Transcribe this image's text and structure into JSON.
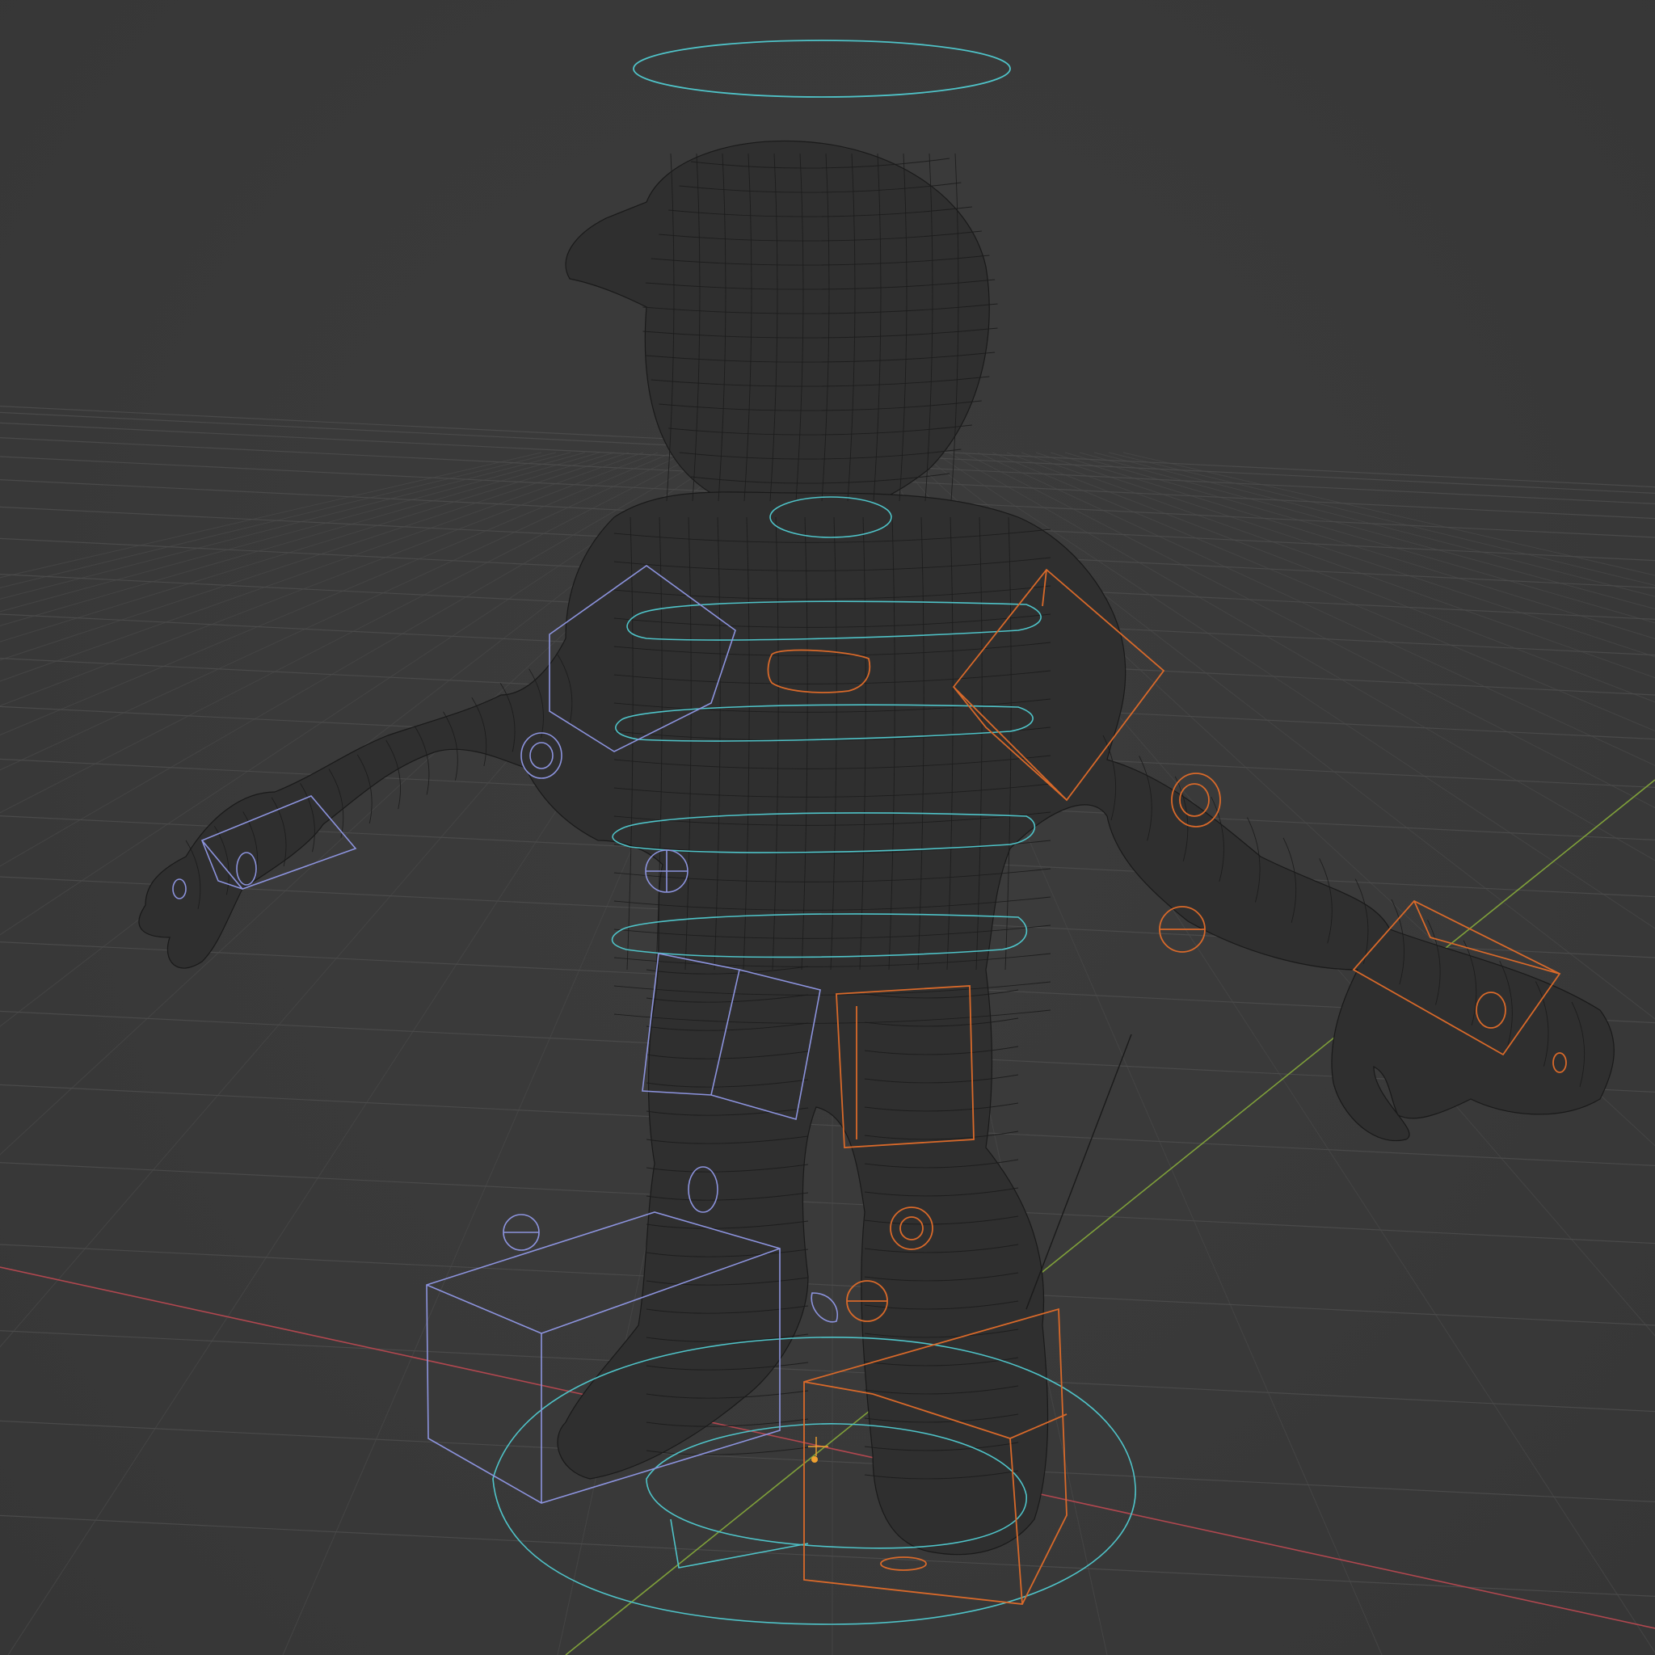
{
  "viewport": {
    "background": "#3a3a3a",
    "mode": "wireframe"
  },
  "colors": {
    "grid": "#4a4a4a",
    "axis_x": "#b0474f",
    "axis_y": "#7fa03a",
    "mesh_wire": "#1c1c1c",
    "rig_center": "#4fc3c8",
    "rig_left": "#8c93dd",
    "rig_right": "#d8692a",
    "origin": "#f0a030"
  },
  "scene": {
    "object": "character-mesh",
    "rig": "control-rig",
    "icons": [
      "origin-icon",
      "cursor-3d-icon"
    ]
  }
}
